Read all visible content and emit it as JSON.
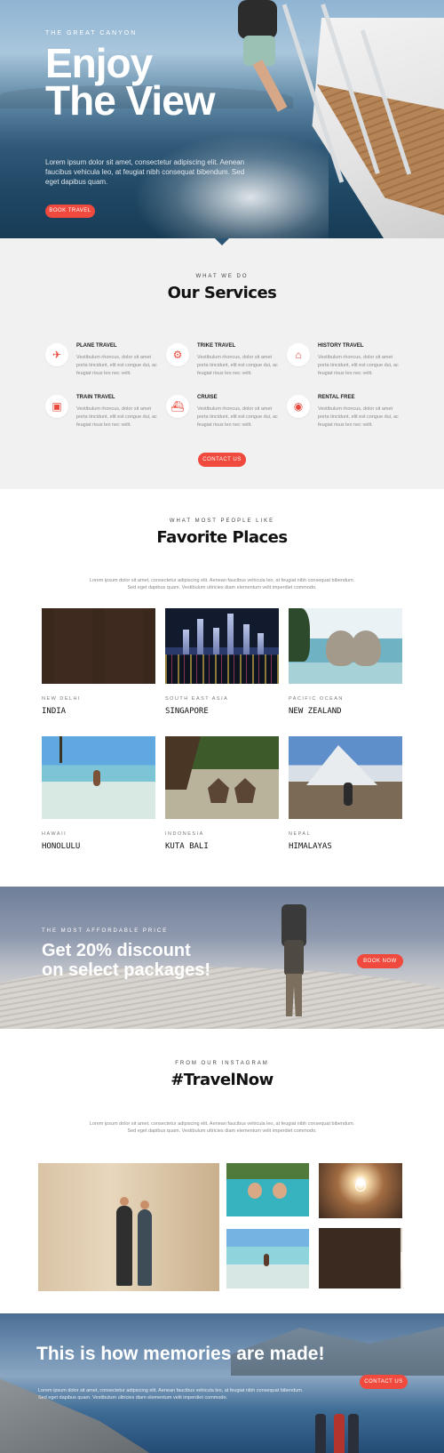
{
  "hero": {
    "eyebrow": "THE GREAT CANYON",
    "title_line1": "Enjoy",
    "title_line2": "The View",
    "lead": "Lorem ipsum dolor sit amet, consectetur adipiscing elit. Aenean faucibus vehicula leo, at feugiat nibh consequat bibendum. Sed eget dapibus quam.",
    "button": "BOOK TRAVEL"
  },
  "services": {
    "eyebrow": "WHAT WE DO",
    "title": "Our Services",
    "items": [
      {
        "name": "PLANE TRAVEL",
        "icon": "plane-icon",
        "glyph": "✈",
        "desc": "Vestibulum rhoncus, dolor sit amet porta tincidunt, elit est congue dui, ac feugiat risus leo nec velit."
      },
      {
        "name": "TRIKE TRAVEL",
        "icon": "motorcycle-icon",
        "glyph": "🏍",
        "desc": "Vestibulum rhoncus, dolor sit amet porta tincidunt, elit est congue dui, ac feugiat risus leo nec velit."
      },
      {
        "name": "HISTORY TRAVEL",
        "icon": "temple-icon",
        "glyph": "⛩",
        "desc": "Vestibulum rhoncus, dolor sit amet porta tincidunt, elit est congue dui, ac feugiat risus leo nec velit."
      },
      {
        "name": "TRAIN TRAVEL",
        "icon": "train-icon",
        "glyph": "🚆",
        "desc": "Vestibulum rhoncus, dolor sit amet porta tincidunt, elit est congue dui, ac feugiat risus leo nec velit."
      },
      {
        "name": "CRUISE",
        "icon": "ship-icon",
        "glyph": "🚢",
        "desc": "Vestibulum rhoncus, dolor sit amet porta tincidunt, elit est congue dui, ac feugiat risus leo nec velit."
      },
      {
        "name": "RENTAL FREE",
        "icon": "car-icon",
        "glyph": "🚗",
        "desc": "Vestibulum rhoncus, dolor sit amet porta tincidunt, elit est congue dui, ac feugiat risus leo nec velit."
      }
    ],
    "button": "CONTACT US"
  },
  "places": {
    "eyebrow": "WHAT MOST PEOPLE LIKE",
    "title": "Favorite Places",
    "intro": "Lorem ipsum dolor sit amet, consectetur adipiscing elit. Aenean faucibus vehicula leo, at feugiat nibh consequat bibendum. Sed eget dapibus quam. Vestibulum ultricies diam elementum velit imperdiet commodo.",
    "items": [
      {
        "location": "NEW DELHI",
        "name": "INDIA"
      },
      {
        "location": "SOUTH EAST ASIA",
        "name": "SINGAPORE"
      },
      {
        "location": "PACIFIC OCEAN",
        "name": "NEW ZEALAND"
      },
      {
        "location": "HAWAII",
        "name": "HONOLULU"
      },
      {
        "location": "INDONESIA",
        "name": "KUTA BALI"
      },
      {
        "location": "NEPAL",
        "name": "HIMALAYAS"
      }
    ]
  },
  "discount": {
    "eyebrow": "THE MOST AFFORDABLE PRICE",
    "title_line1": "Get 20% discount",
    "title_line2": "on select packages!",
    "button": "BOOK NOW"
  },
  "instagram": {
    "eyebrow": "FROM OUR INSTAGRAM",
    "title": "#TravelNow",
    "intro": "Lorem ipsum dolor sit amet, consectetur adipiscing elit. Aenean faucibus vehicula leo, at feugiat nibh consequat bibendum. Sed eget dapibus quam. Vestibulum ultricies diam elementum velit imperdiet commodo."
  },
  "memories": {
    "title": "This is how memories are made!",
    "lead": "Lorem ipsum dolor sit amet, consectetur adipiscing elit. Aenean faucibus vehicula leo, at feugiat nibh consequat bibendum. Sed eget dapibus quam. Vestibulum ultricies diam elementum velit imperdiet commodo.",
    "button": "CONTACT US"
  },
  "colors": {
    "accent": "#ef4a3d",
    "section_gray": "#f1f1f2"
  }
}
